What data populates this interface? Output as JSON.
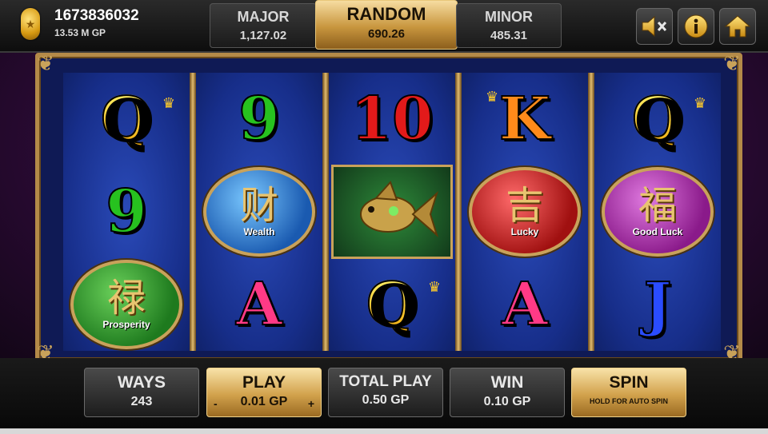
{
  "account": {
    "balance": "1673836032",
    "gp": "13.53 M GP"
  },
  "jackpots": {
    "major": {
      "label": "MAJOR",
      "value": "1,127.02"
    },
    "random": {
      "label": "RANDOM",
      "value": "690.26"
    },
    "minor": {
      "label": "MINOR",
      "value": "485.31"
    }
  },
  "top_buttons": {
    "mute_icon": "speaker-mute-icon",
    "info_icon": "info-icon",
    "home_icon": "home-icon"
  },
  "reels": [
    [
      {
        "symbol": "Q",
        "kind": "letter"
      },
      {
        "symbol": "9",
        "kind": "number"
      },
      {
        "symbol": "禄",
        "kind": "medal",
        "label": "Prosperity"
      }
    ],
    [
      {
        "symbol": "9",
        "kind": "number"
      },
      {
        "symbol": "财",
        "kind": "medal",
        "label": "Wealth"
      },
      {
        "symbol": "A",
        "kind": "letter"
      }
    ],
    [
      {
        "symbol": "10",
        "kind": "number"
      },
      {
        "symbol": "koi-fish",
        "kind": "wild"
      },
      {
        "symbol": "Q",
        "kind": "letter"
      }
    ],
    [
      {
        "symbol": "K",
        "kind": "letter"
      },
      {
        "symbol": "吉",
        "kind": "medal",
        "label": "Lucky"
      },
      {
        "symbol": "A",
        "kind": "letter"
      }
    ],
    [
      {
        "symbol": "Q",
        "kind": "letter"
      },
      {
        "symbol": "福",
        "kind": "medal",
        "label": "Good Luck"
      },
      {
        "symbol": "J",
        "kind": "letter"
      }
    ]
  ],
  "bottom": {
    "ways": {
      "label": "WAYS",
      "value": "243"
    },
    "play": {
      "label": "PLAY",
      "value": "0.01 GP",
      "minus": "-",
      "plus": "+"
    },
    "total_play": {
      "label": "TOTAL PLAY",
      "value": "0.50 GP"
    },
    "win": {
      "label": "WIN",
      "value": "0.10 GP"
    },
    "spin": {
      "label": "SPIN",
      "sub": "HOLD FOR AUTO SPIN"
    }
  },
  "colors": {
    "accent_gold": "#d2a24c",
    "reel_blue": "#172e8a",
    "frame_gold": "#b48a48"
  }
}
